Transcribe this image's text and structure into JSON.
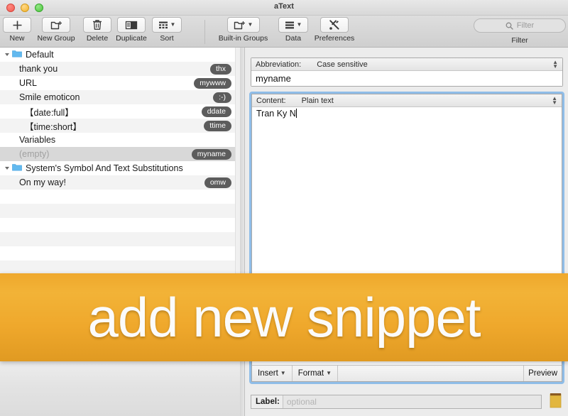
{
  "window": {
    "title": "aText",
    "traffic_lights": [
      "close-button",
      "minimize-button",
      "zoom-button"
    ]
  },
  "toolbar": {
    "items": [
      {
        "label": "New",
        "icon": "plus-icon"
      },
      {
        "label": "New Group",
        "icon": "new-folder-icon"
      },
      {
        "label": "Delete",
        "icon": "trash-icon"
      },
      {
        "label": "Duplicate",
        "icon": "duplicate-icon"
      },
      {
        "label": "Sort",
        "icon": "sort-grid-icon"
      },
      {
        "label": "Built-in Groups",
        "icon": "new-folder-icon"
      },
      {
        "label": "Data",
        "icon": "data-lines-icon"
      },
      {
        "label": "Preferences",
        "icon": "tools-icon"
      }
    ],
    "filter": {
      "placeholder": "Filter",
      "caption": "Filter",
      "icon": "search-icon"
    }
  },
  "sidebar": {
    "rows": [
      {
        "label": "Default",
        "abbr": "",
        "type": "group",
        "style": "white",
        "indent": 0
      },
      {
        "label": "thank you",
        "abbr": "thx",
        "type": "snippet",
        "style": "alt",
        "indent": 1
      },
      {
        "label": "URL",
        "abbr": "mywww",
        "type": "snippet",
        "style": "white",
        "indent": 1
      },
      {
        "label": "Smile emoticon",
        "abbr": ":-)",
        "type": "snippet",
        "style": "alt",
        "indent": 1
      },
      {
        "label": "【date:full】",
        "abbr": "ddate",
        "type": "snippet",
        "style": "white",
        "indent": 2
      },
      {
        "label": "【time:short】",
        "abbr": "ttime",
        "type": "snippet",
        "style": "alt",
        "indent": 2
      },
      {
        "label": "Variables",
        "abbr": "",
        "type": "snippet",
        "style": "white",
        "indent": 1
      },
      {
        "label": "(empty)",
        "abbr": "myname",
        "type": "snippet",
        "style": "sel",
        "indent": 1
      },
      {
        "label": "System's Symbol And Text Substitutions",
        "abbr": "",
        "type": "group",
        "style": "white",
        "indent": 0
      },
      {
        "label": "On my way!",
        "abbr": "omw",
        "type": "snippet",
        "style": "alt",
        "indent": 1
      }
    ],
    "empty_row_count": 14
  },
  "detail": {
    "abbreviation": {
      "label": "Abbreviation:",
      "mode": "Case sensitive",
      "value": "myname"
    },
    "content": {
      "label": "Content:",
      "mode": "Plain text",
      "value": "Tran Ky N"
    },
    "content_toolbar": {
      "insert": "Insert",
      "format": "Format",
      "preview": "Preview"
    },
    "label_row": {
      "label": "Label:",
      "placeholder": "optional",
      "icon": "notepad-icon"
    }
  },
  "overlay": {
    "banner_text": "add new snippet",
    "banner_color": "#efa82c",
    "text_color": "#fbfbfb"
  }
}
